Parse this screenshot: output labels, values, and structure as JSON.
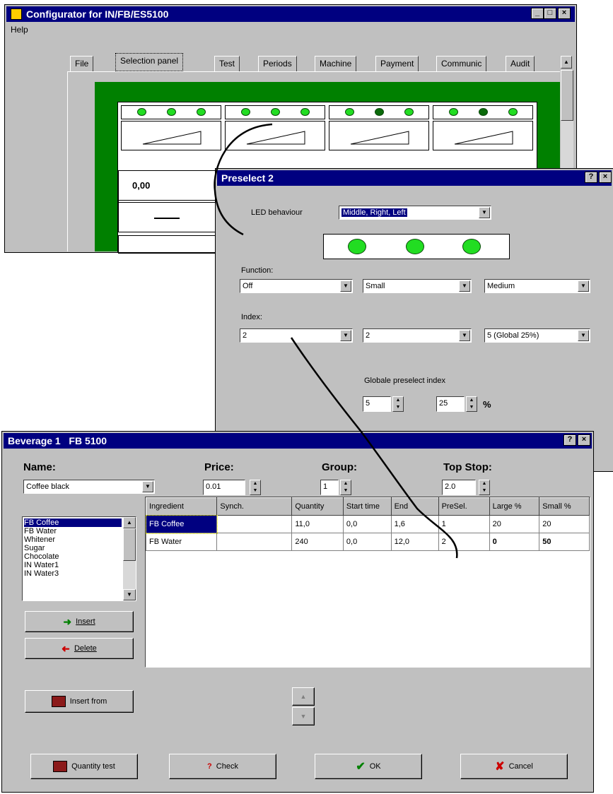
{
  "configurator": {
    "title": "Configurator for IN/FB/ES5100",
    "menu_help": "Help",
    "tabs": [
      "File",
      "Selection panel",
      "Test",
      "Periods",
      "Machine",
      "Payment",
      "Communic",
      "Audit"
    ],
    "display_value": "0,00"
  },
  "preselect": {
    "title": "Preselect 2",
    "led_behaviour_label": "LED behaviour",
    "led_behaviour_value": "Middle, Right, Left",
    "function_label": "Function:",
    "functions": [
      "Off",
      "Small",
      "Medium"
    ],
    "index_label": "Index:",
    "indexes": [
      "2",
      "2",
      "5 (Global 25%)"
    ],
    "global_label": "Globale preselect index",
    "global_index": "5",
    "global_percent": "25",
    "percent_sign": "%"
  },
  "beverage": {
    "title": "Beverage 1   FB 5100",
    "name_label": "Name:",
    "name_value": "Coffee black",
    "price_label": "Price:",
    "price_value": "0.01",
    "group_label": "Group:",
    "group_value": "1",
    "topstop_label": "Top Stop:",
    "topstop_value": "2.0",
    "ingredients_list": [
      "FB Coffee",
      "FB Water",
      "Whitener",
      "Sugar",
      "Chocolate",
      "IN Water1",
      "IN Water3"
    ],
    "insert_label": "Insert",
    "delete_label": "Delete",
    "insert_from_label": "Insert from",
    "table_headers": [
      "Ingredient",
      "Synch.",
      "Quantity",
      "Start time",
      "End",
      "PreSel.",
      "Large %",
      "Small %"
    ],
    "table_rows": [
      [
        "FB Coffee",
        "",
        "11,0",
        "0,0",
        "1,6",
        "1",
        "20",
        "20"
      ],
      [
        "FB Water",
        "",
        "240",
        "0,0",
        "12,0",
        "2",
        "0",
        "50"
      ]
    ],
    "quantity_test_label": "Quantity test",
    "check_label": "Check",
    "ok_label": "OK",
    "cancel_label": "Cancel"
  },
  "colors": {
    "titlebar": "#000080",
    "panel_green": "#008000",
    "led_green": "#22dd22",
    "face": "#c0c0c0"
  }
}
